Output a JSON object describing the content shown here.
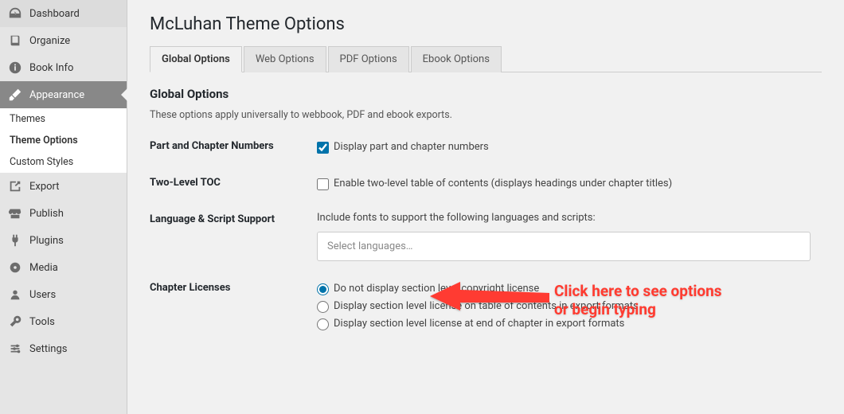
{
  "sidebar": {
    "items": [
      {
        "label": "Dashboard",
        "icon": "dashboard-icon"
      },
      {
        "label": "Organize",
        "icon": "book-icon"
      },
      {
        "label": "Book Info",
        "icon": "info-icon"
      },
      {
        "label": "Appearance",
        "icon": "brush-icon"
      },
      {
        "label": "Export",
        "icon": "export-icon"
      },
      {
        "label": "Publish",
        "icon": "store-icon"
      },
      {
        "label": "Plugins",
        "icon": "plug-icon"
      },
      {
        "label": "Media",
        "icon": "media-icon"
      },
      {
        "label": "Users",
        "icon": "users-icon"
      },
      {
        "label": "Tools",
        "icon": "tools-icon"
      },
      {
        "label": "Settings",
        "icon": "settings-icon"
      }
    ],
    "sub": [
      {
        "label": "Themes"
      },
      {
        "label": "Theme Options"
      },
      {
        "label": "Custom Styles"
      }
    ]
  },
  "page": {
    "title": "McLuhan Theme Options",
    "tabs": [
      {
        "label": "Global Options"
      },
      {
        "label": "Web Options"
      },
      {
        "label": "PDF Options"
      },
      {
        "label": "Ebook Options"
      }
    ],
    "section_heading": "Global Options",
    "section_desc": "These options apply universally to webbook, PDF and ebook exports.",
    "rows": {
      "part_chapter": {
        "label": "Part and Chapter Numbers",
        "option": "Display part and chapter numbers"
      },
      "toc": {
        "label": "Two-Level TOC",
        "option": "Enable two-level table of contents (displays headings under chapter titles)"
      },
      "lang": {
        "label": "Language & Script Support",
        "desc": "Include fonts to support the following languages and scripts:",
        "placeholder": "Select languages…"
      },
      "licenses": {
        "label": "Chapter Licenses",
        "options": [
          "Do not display section level copyright license",
          "Display section level license on table of contents in export formats",
          "Display section level license at end of chapter in export formats"
        ]
      }
    }
  },
  "annotation": {
    "line1": "Click here to see options",
    "line2": "or begin typing"
  }
}
